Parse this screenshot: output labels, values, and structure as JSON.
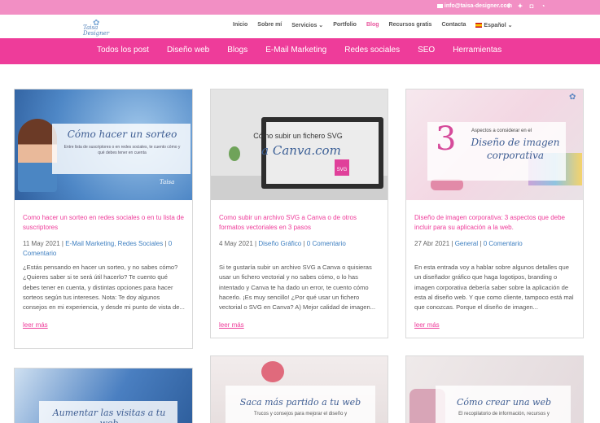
{
  "topbar": {
    "email": "info@taisa-designer.com",
    "social": [
      "f-icon",
      "twitter-icon",
      "instagram-icon",
      "rss-icon"
    ]
  },
  "header": {
    "logo_line1": "Taisa",
    "logo_line2": "Designer",
    "nav": [
      {
        "label": "Inicio"
      },
      {
        "label": "Sobre mí"
      },
      {
        "label": "Servicios ⌄"
      },
      {
        "label": "Portfolio"
      },
      {
        "label": "Blog",
        "active": true
      },
      {
        "label": "Recursos gratis"
      },
      {
        "label": "Contacta"
      },
      {
        "label": "Español ⌄",
        "flag": true
      }
    ]
  },
  "categories": [
    "Todos los post",
    "Diseño web",
    "Blogs",
    "E-Mail Marketing",
    "Redes sociales",
    "SEO",
    "Herramientas"
  ],
  "posts": [
    {
      "thumb_title": "Cómo hacer un sorteo",
      "thumb_sub": "Entre lista de suscriptores o en redes sociales, te cuento cómo y qué debes tener en cuenta",
      "title": "Como hacer un sorteo en redes sociales o en tu lista de suscriptores",
      "date": "11 May 2021",
      "cats": "E-Mail Marketing, Redes Sociales",
      "comments": "0 Comentario",
      "excerpt": "¿Estás pensando en hacer un sorteo, y no sabes cómo? ¿Quieres saber si te será útil hacerlo? Te cuento qué debes tener en cuenta, y distintas opciones para hacer sorteos según tus intereses. Nota: Te doy algunos consejos en mi experiencia, y desde mi punto de vista de...",
      "more": "leer más"
    },
    {
      "thumb_title": "Cómo subir un fichero SVG",
      "thumb_title2": "a Canva.com",
      "title": "Como subir un archivo SVG a Canva o de otros formatos vectoriales en 3 pasos",
      "date": "4 May 2021",
      "cats": "Diseño Gráfico",
      "comments": "0 Comentario",
      "excerpt": "Si te gustaría subir un archivo SVG a Canva o quisieras usar un fichero vectorial y no sabes cómo, o lo has intentado y Canva te ha dado un error, te cuento cómo hacerlo. ¡Es muy sencillo! ¿Por qué usar un fichero vectorial o SVG en Canva? A) Mejor calidad de imagen...",
      "more": "leer más"
    },
    {
      "thumb_num": "3",
      "thumb_small": "Aspectos a considerar en el",
      "thumb_title": "Diseño de imagen",
      "thumb_title2": "corporativa",
      "title": "Diseño de imagen corporativa: 3 aspectos que debe incluir para su aplicación a la web.",
      "date": "27 Abr 2021",
      "cats": "General",
      "comments": "0 Comentario",
      "excerpt": "En esta entrada voy a hablar sobre algunos detalles que un diseñador gráfico que haga logotipos, branding o imagen corporativa debería saber sobre la aplicación de esta al diseño web. Y que como cliente, tampoco está mal que conozcas. Porque el diseño de imagen...",
      "more": "leer más"
    }
  ],
  "posts_row2": [
    {
      "thumb_title": "Aumentar las visitas a tu web"
    },
    {
      "thumb_title": "Saca más partido a tu web",
      "thumb_sub": "Trucos y consejos para mejorar el diseño y"
    },
    {
      "thumb_title": "Cómo crear una web",
      "thumb_sub": "El recopilatorio de información, recursos y"
    }
  ]
}
